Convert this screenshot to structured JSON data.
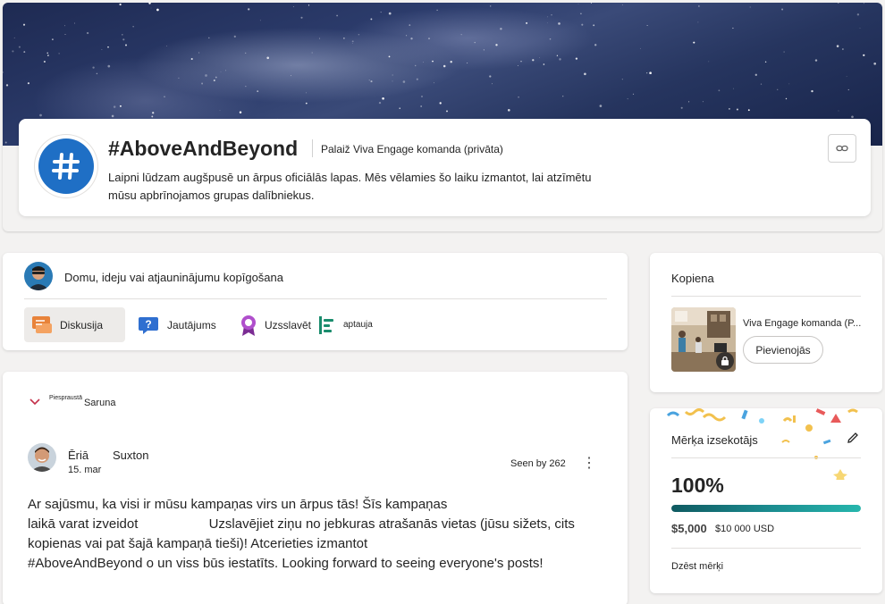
{
  "group": {
    "title": "#AboveAndBeyond",
    "meta": "Palaiž Viva Engage komanda (privāta)",
    "description": "Laipni lūdzam augšpusē un ārpus oficiālās lapas. Mēs vēlamies šo laiku izmantot, lai atzīmētu mūsu apbrīnojamos grupas dalībniekus.",
    "avatar_icon": "hashtag-icon",
    "link_icon": "link-icon"
  },
  "composer": {
    "prompt": "Domu, ideju vai atjauninājumu kopīgošana",
    "types": [
      {
        "label": "Diskusija",
        "icon": "discussion-icon",
        "color": "#e8833a",
        "active": true
      },
      {
        "label": "Jautājums",
        "icon": "question-icon",
        "color": "#2f6fd0",
        "active": false
      },
      {
        "label": "Uzsslavēt",
        "icon": "praise-icon",
        "color": "#9b3fb6",
        "active": false
      },
      {
        "label": "aptauja",
        "icon": "poll-icon",
        "color": "#1a8c6d",
        "active": false
      }
    ]
  },
  "post": {
    "pinned_small": "Piespraustā",
    "pinned_label": "Saruna",
    "author_first": "Ēriā",
    "author_last": "Suxton",
    "date": "15. mar",
    "seen": "Seen by 262",
    "more": "⋮",
    "body_lines": [
      "Ar sajūsmu, ka visi ir mūsu kampaņas virs un ārpus tās! Šīs kampaņas",
      "laikā varat izveidot                   Uzslavējiet ziņu no jebkuras atrašanās vietas (jūsu sižets, cits",
      "kopienas vai pat šajā kampaņā tieši)! Atcerieties izmantot",
      "#AboveAndBeyond o un viss būs iestatīts. Looking forward to seeing everyone's posts!"
    ]
  },
  "community": {
    "title": "Kopiena",
    "name": "Viva Engage komanda (P...",
    "join": "Pievienojās"
  },
  "goal": {
    "title": "Mērķa izsekotājs",
    "percent": "100%",
    "progress_fraction": 1.0,
    "current": "$5,000",
    "target": "$10 000 USD",
    "delete": "Dzēst mērķi"
  }
}
